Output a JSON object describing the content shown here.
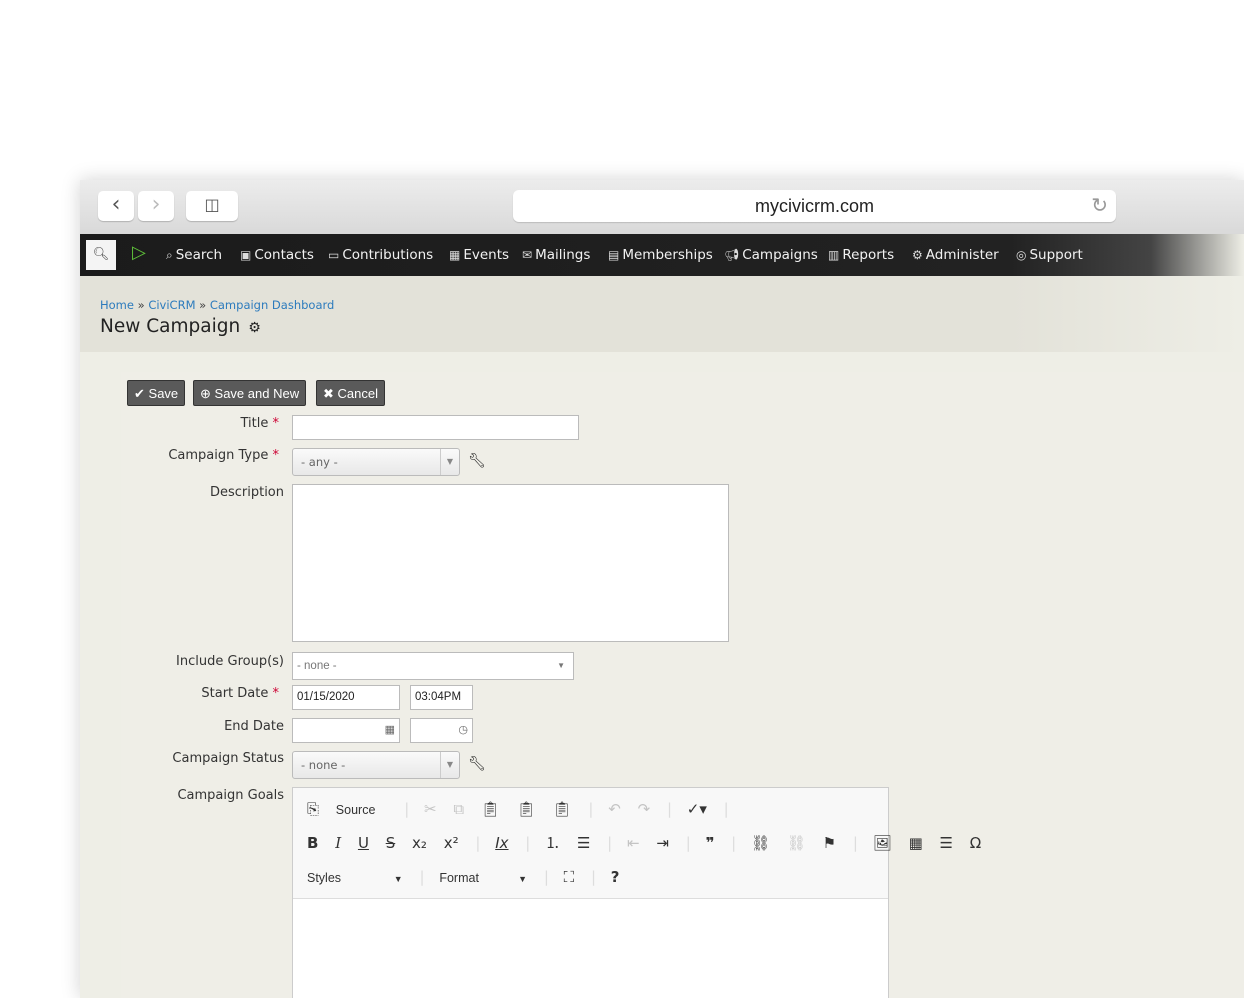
{
  "browser": {
    "address": "mycivicrm.com",
    "back_icon": "chevron-left-icon",
    "forward_icon": "chevron-right-icon",
    "sidebar_icon": "sidebar-icon",
    "reload_icon": "reload-icon"
  },
  "menu": {
    "items": [
      {
        "label": "Search",
        "icon": "search-icon"
      },
      {
        "label": "Contacts",
        "icon": "contact-card-icon"
      },
      {
        "label": "Contributions",
        "icon": "credit-card-icon"
      },
      {
        "label": "Events",
        "icon": "calendar-icon"
      },
      {
        "label": "Mailings",
        "icon": "envelope-icon"
      },
      {
        "label": "Memberships",
        "icon": "id-badge-icon"
      },
      {
        "label": "Campaigns",
        "icon": "bullhorn-icon"
      },
      {
        "label": "Reports",
        "icon": "bar-chart-icon"
      },
      {
        "label": "Administer",
        "icon": "gears-icon"
      },
      {
        "label": "Support",
        "icon": "life-ring-icon"
      }
    ]
  },
  "breadcrumb": {
    "items": [
      "Home",
      "CiviCRM",
      "Campaign Dashboard"
    ],
    "separator": "»"
  },
  "page": {
    "title": "New Campaign"
  },
  "buttons": {
    "save": "Save",
    "save_new": "Save and New",
    "cancel": "Cancel"
  },
  "form": {
    "title_label": "Title",
    "campaign_type_label": "Campaign Type",
    "campaign_type_value": "- any -",
    "description_label": "Description",
    "include_groups_label": "Include Group(s)",
    "include_groups_value": "- none -",
    "start_date_label": "Start Date",
    "start_date_value": "01/15/2020",
    "start_time_value": "03:04PM",
    "end_date_label": "End Date",
    "campaign_status_label": "Campaign Status",
    "campaign_status_value": "- none -",
    "campaign_goals_label": "Campaign Goals",
    "required_marker": "*"
  },
  "editor": {
    "source_label": "Source",
    "styles_label": "Styles",
    "format_label": "Format"
  }
}
